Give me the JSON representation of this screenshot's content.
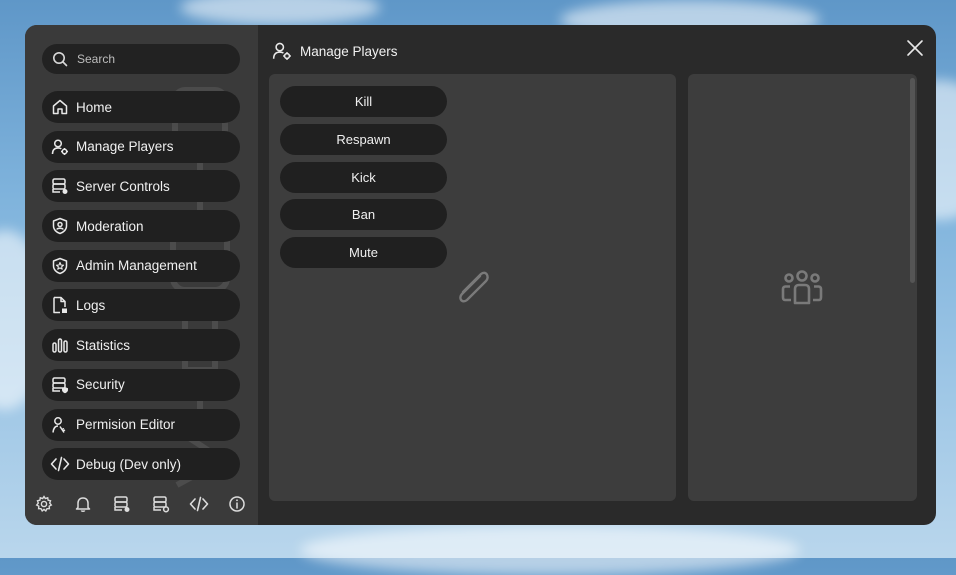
{
  "search": {
    "placeholder": "Search"
  },
  "nav": {
    "items": [
      {
        "label": "Home",
        "icon": "home-icon"
      },
      {
        "label": "Manage Players",
        "icon": "user-settings-icon"
      },
      {
        "label": "Server Controls",
        "icon": "server-icon"
      },
      {
        "label": "Moderation",
        "icon": "shield-user-icon"
      },
      {
        "label": "Admin Management",
        "icon": "shield-star-icon"
      },
      {
        "label": "Logs",
        "icon": "file-icon"
      },
      {
        "label": "Statistics",
        "icon": "bar-chart-icon"
      },
      {
        "label": "Security",
        "icon": "server-shield-icon"
      },
      {
        "label": "Permision Editor",
        "icon": "key-user-icon"
      },
      {
        "label": "Debug (Dev only)",
        "icon": "code-icon"
      }
    ]
  },
  "bottom_icons": [
    "gear-icon",
    "bell-icon",
    "server-icon",
    "server-settings-icon",
    "code-icon",
    "info-icon"
  ],
  "header": {
    "title": "Manage Players"
  },
  "actions": [
    "Kill",
    "Respawn",
    "Kick",
    "Ban",
    "Mute"
  ],
  "colors": {
    "window_bg": "#2a2a2a",
    "sidebar_bg": "#3a3a3a",
    "button_bg": "#202020",
    "panel_bg": "#3d3d3d",
    "text": "#f0f0f0"
  }
}
